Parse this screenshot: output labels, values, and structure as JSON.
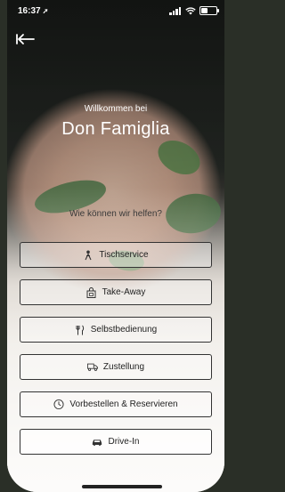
{
  "status_bar": {
    "time": "16:37",
    "location_icon": "location-arrow-icon",
    "signal_icon": "cellular-signal-icon",
    "wifi_icon": "wifi-icon",
    "battery_icon": "battery-icon",
    "battery_level": 0.5
  },
  "nav": {
    "back_icon": "back-arrow-icon"
  },
  "header": {
    "welcome": "Willkommen bei",
    "restaurant_name": "Don Famiglia",
    "question": "Wie können wir helfen?"
  },
  "options": [
    {
      "label": "Tischservice",
      "icon": "waiter-icon"
    },
    {
      "label": "Take-Away",
      "icon": "takeaway-bag-icon"
    },
    {
      "label": "Selbstbedienung",
      "icon": "cutlery-icon"
    },
    {
      "label": "Zustellung",
      "icon": "delivery-truck-icon"
    },
    {
      "label": "Vorbestellen & Reservieren",
      "icon": "clock-icon"
    },
    {
      "label": "Drive-In",
      "icon": "car-icon"
    }
  ],
  "colors": {
    "button_border": "#333333",
    "text_dark": "#222222",
    "text_light": "#ffffff"
  }
}
